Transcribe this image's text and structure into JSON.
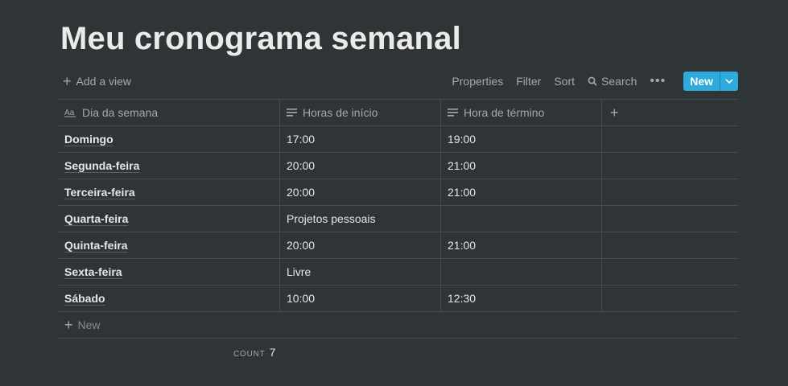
{
  "page": {
    "title": "Meu cronograma semanal"
  },
  "toolbar": {
    "add_view_label": "Add a view",
    "properties_label": "Properties",
    "filter_label": "Filter",
    "sort_label": "Sort",
    "search_label": "Search",
    "more_label": "•••",
    "new_label": "New",
    "accent_color": "#2eaadc"
  },
  "table": {
    "columns": [
      {
        "label": "Dia da semana",
        "icon": "title-aa-icon"
      },
      {
        "label": "Horas de início",
        "icon": "text-lines-icon"
      },
      {
        "label": "Hora de término",
        "icon": "text-lines-icon"
      }
    ],
    "rows": [
      {
        "day": "Domingo",
        "start": "17:00",
        "end": "19:00"
      },
      {
        "day": "Segunda-feira",
        "start": "20:00",
        "end": "21:00"
      },
      {
        "day": "Terceira-feira",
        "start": "20:00",
        "end": "21:00"
      },
      {
        "day": "Quarta-feira",
        "start": "Projetos pessoais",
        "end": ""
      },
      {
        "day": "Quinta-feira",
        "start": "20:00",
        "end": "21:00"
      },
      {
        "day": "Sexta-feira",
        "start": "Livre",
        "end": ""
      },
      {
        "day": "Sábado",
        "start": "10:00",
        "end": "12:30"
      }
    ],
    "new_row_label": "New"
  },
  "footer": {
    "count_label": "COUNT",
    "count_value": "7"
  }
}
